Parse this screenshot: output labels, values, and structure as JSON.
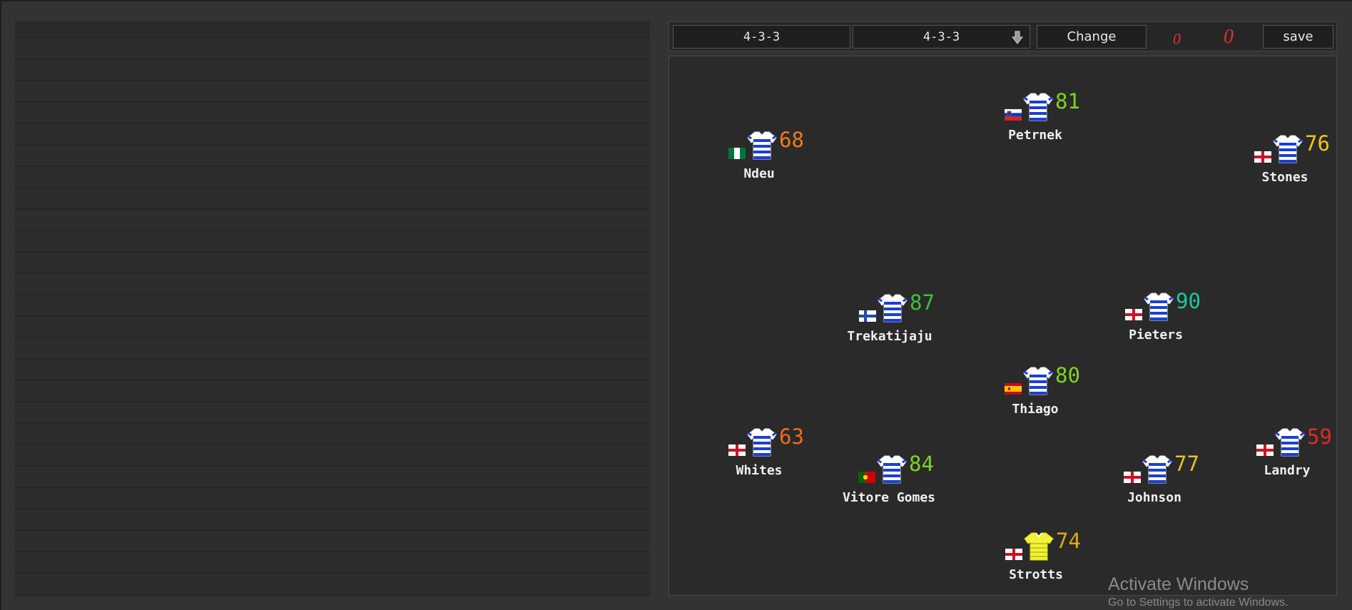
{
  "toolbar": {
    "current_formation": "4-3-3",
    "selected_formation": "4-3-3",
    "change_label": "Change",
    "save_label": "save",
    "score_home": "0",
    "score_away": "0"
  },
  "left_list": {
    "row_count": 27
  },
  "colors": {
    "rating_orange": "#f07a1e",
    "rating_lightgreen": "#7ed321",
    "rating_green": "#3fbf3f",
    "rating_teal": "#1fc8a0",
    "rating_yellow": "#f0c419",
    "rating_red": "#e02828",
    "rating_gold": "#e0a818",
    "jersey_outfield": "#1a3fd8",
    "jersey_keeper": "#f2f23c"
  },
  "players": [
    {
      "name": "Ndeu",
      "rating": "68",
      "rating_color": "#f07a1e",
      "flag": "nigeria",
      "jersey": "outfield"
    },
    {
      "name": "Petrnek",
      "rating": "81",
      "rating_color": "#7ed321",
      "flag": "slovenia",
      "jersey": "outfield"
    },
    {
      "name": "Stones",
      "rating": "76",
      "rating_color": "#f0c419",
      "flag": "england",
      "jersey": "outfield"
    },
    {
      "name": "Trekatijaju",
      "rating": "87",
      "rating_color": "#3fbf3f",
      "flag": "finland",
      "jersey": "outfield"
    },
    {
      "name": "Pieters",
      "rating": "90",
      "rating_color": "#1fc8a0",
      "flag": "england",
      "jersey": "outfield"
    },
    {
      "name": "Thiago",
      "rating": "80",
      "rating_color": "#7ed321",
      "flag": "spain",
      "jersey": "outfield"
    },
    {
      "name": "Whites",
      "rating": "63",
      "rating_color": "#f06a1e",
      "flag": "england",
      "jersey": "outfield"
    },
    {
      "name": "Vitore Gomes",
      "rating": "84",
      "rating_color": "#7ed321",
      "flag": "portugal",
      "jersey": "outfield"
    },
    {
      "name": "Johnson",
      "rating": "77",
      "rating_color": "#e8c020",
      "flag": "england",
      "jersey": "outfield"
    },
    {
      "name": "Landry",
      "rating": "59",
      "rating_color": "#e02828",
      "flag": "england",
      "jersey": "outfield"
    },
    {
      "name": "Strotts",
      "rating": "74",
      "rating_color": "#e0a818",
      "flag": "england",
      "jersey": "keeper"
    }
  ],
  "watermark": {
    "title": "Activate Windows",
    "subtitle": "Go to Settings to activate Windows."
  }
}
